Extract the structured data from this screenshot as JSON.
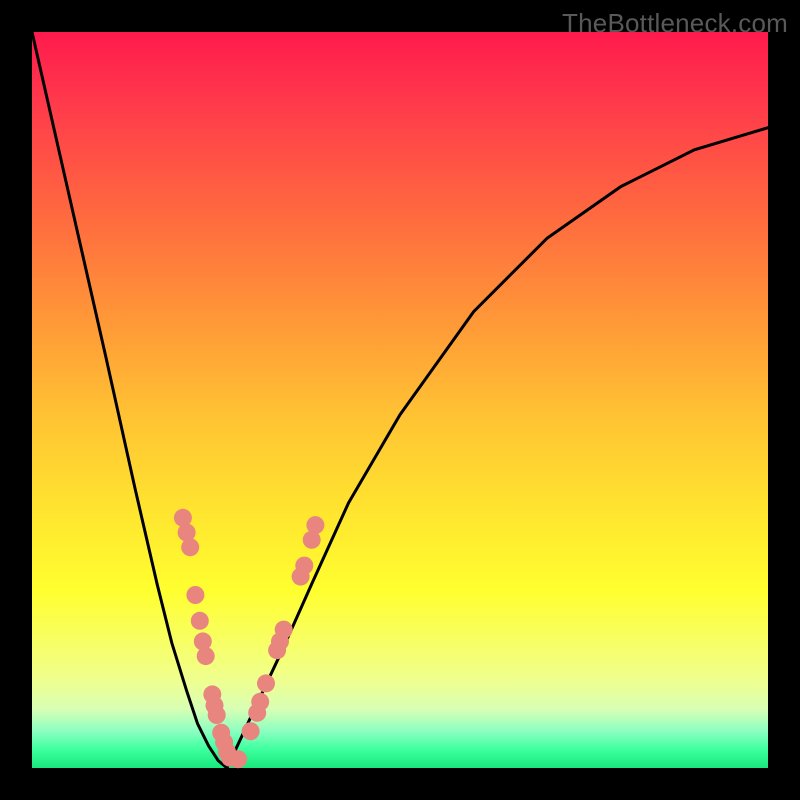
{
  "watermark": "TheBottleneck.com",
  "colors": {
    "curve": "#000000",
    "marker": "#e9857f",
    "gradient_top": "#ff1a4d",
    "gradient_bottom": "#18e87b",
    "frame": "#000000"
  },
  "chart_data": {
    "type": "line",
    "title": "",
    "xlabel": "",
    "ylabel": "",
    "xlim": [
      0,
      1
    ],
    "ylim": [
      0,
      1
    ],
    "series": [
      {
        "name": "left-curve",
        "x": [
          0.0,
          0.05,
          0.1,
          0.14,
          0.17,
          0.19,
          0.21,
          0.225,
          0.24,
          0.253,
          0.265
        ],
        "y": [
          1.0,
          0.78,
          0.56,
          0.38,
          0.25,
          0.17,
          0.105,
          0.06,
          0.03,
          0.01,
          0.0
        ]
      },
      {
        "name": "right-curve",
        "x": [
          0.265,
          0.3,
          0.34,
          0.38,
          0.43,
          0.5,
          0.6,
          0.7,
          0.8,
          0.9,
          1.0
        ],
        "y": [
          0.0,
          0.075,
          0.16,
          0.25,
          0.36,
          0.48,
          0.62,
          0.72,
          0.79,
          0.84,
          0.87
        ]
      }
    ],
    "markers": {
      "name": "data-points",
      "points": [
        {
          "x": 0.205,
          "y": 0.34
        },
        {
          "x": 0.21,
          "y": 0.32
        },
        {
          "x": 0.215,
          "y": 0.3
        },
        {
          "x": 0.222,
          "y": 0.235
        },
        {
          "x": 0.228,
          "y": 0.2
        },
        {
          "x": 0.232,
          "y": 0.172
        },
        {
          "x": 0.236,
          "y": 0.152
        },
        {
          "x": 0.245,
          "y": 0.1
        },
        {
          "x": 0.248,
          "y": 0.085
        },
        {
          "x": 0.251,
          "y": 0.072
        },
        {
          "x": 0.257,
          "y": 0.048
        },
        {
          "x": 0.261,
          "y": 0.035
        },
        {
          "x": 0.265,
          "y": 0.022
        },
        {
          "x": 0.269,
          "y": 0.014
        },
        {
          "x": 0.28,
          "y": 0.012
        },
        {
          "x": 0.297,
          "y": 0.05
        },
        {
          "x": 0.306,
          "y": 0.075
        },
        {
          "x": 0.31,
          "y": 0.09
        },
        {
          "x": 0.318,
          "y": 0.115
        },
        {
          "x": 0.333,
          "y": 0.16
        },
        {
          "x": 0.337,
          "y": 0.172
        },
        {
          "x": 0.342,
          "y": 0.188
        },
        {
          "x": 0.365,
          "y": 0.26
        },
        {
          "x": 0.37,
          "y": 0.275
        },
        {
          "x": 0.38,
          "y": 0.31
        },
        {
          "x": 0.385,
          "y": 0.33
        }
      ]
    }
  }
}
